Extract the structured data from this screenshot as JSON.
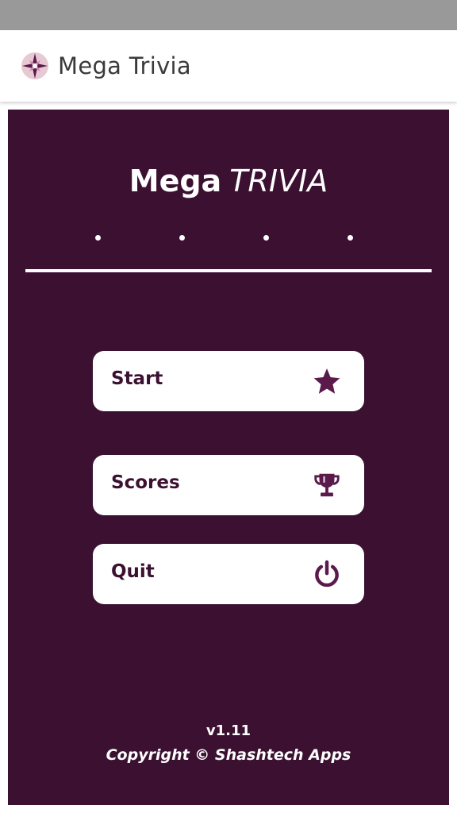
{
  "app_bar": {
    "title": "Mega Trivia",
    "logo_icon": "compass-star-icon"
  },
  "main": {
    "title_part1": "Mega",
    "title_part2": "TRIVIA",
    "dots_count": 4,
    "buttons": [
      {
        "label": "Start",
        "icon": "star-icon"
      },
      {
        "label": "Scores",
        "icon": "trophy-icon"
      },
      {
        "label": "Quit",
        "icon": "power-icon"
      }
    ]
  },
  "footer": {
    "version": "v1.11",
    "copyright": "Copyright © Shashtech Apps"
  },
  "colors": {
    "status_bar": "#999999",
    "panel_background": "#3b1031",
    "accent": "#5a1a4b",
    "button_background": "#ffffff"
  }
}
